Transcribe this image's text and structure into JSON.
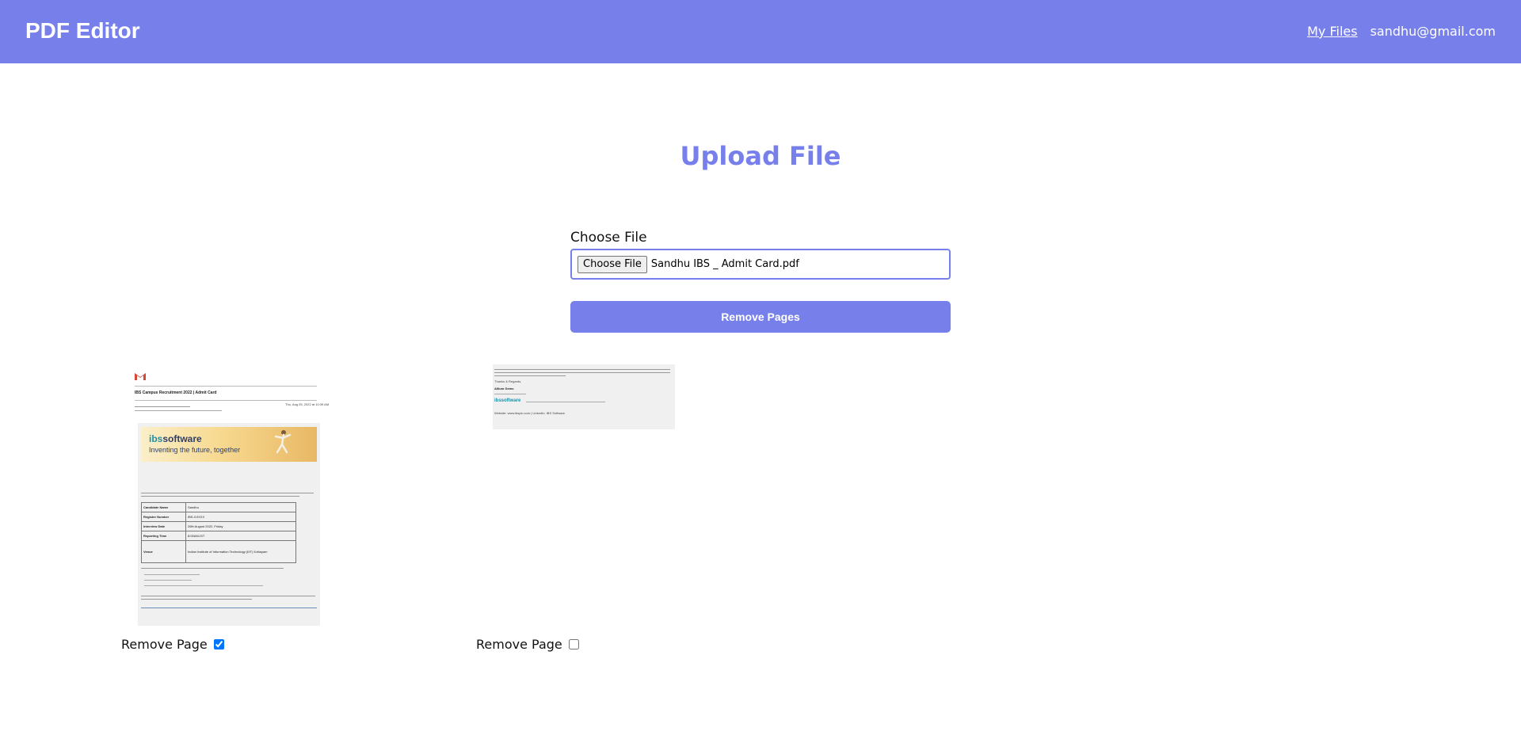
{
  "header": {
    "brand": "PDF Editor",
    "my_files_label": "My Files",
    "user_email": "sandhu@gmail.com",
    "background_color": "#7780ea"
  },
  "main": {
    "title": "Upload File",
    "file_label": "Choose File",
    "file_button_label": "Choose File",
    "file_name": "Sandhu IBS _ Admit Card.pdf",
    "submit_label": "Remove Pages",
    "accent_color": "#7780ea"
  },
  "pages": [
    {
      "checkbox_label": "Remove Page",
      "checked": true,
      "preview": {
        "subject": "IBS Campus Recruitment 2022 | Admit Card",
        "date": "Thu, Aug 25, 2022 at 10:39 AM",
        "banner_brand_a": "ibs",
        "banner_brand_b": "software",
        "banner_tagline": "Inventing the future, together",
        "table_keys": [
          "Candidate Name",
          "Register Number",
          "Interview Date",
          "Reporting Time",
          "Venue"
        ],
        "table_values": [
          "Sandhu",
          "IBS-XXXXX",
          "26th August 2022, Friday",
          "8:00AM-IST",
          "Indian Institute of Information Technology (IIIT) Kottayam"
        ]
      }
    },
    {
      "checkbox_label": "Remove Page",
      "checked": false,
      "preview": {
        "closing": "Thanks & Regards,",
        "signature": "Allium Gems",
        "brand": "ibssoftware",
        "links": "Website: www.ibsplc.com | LinkedIn: IBS Software"
      }
    }
  ]
}
